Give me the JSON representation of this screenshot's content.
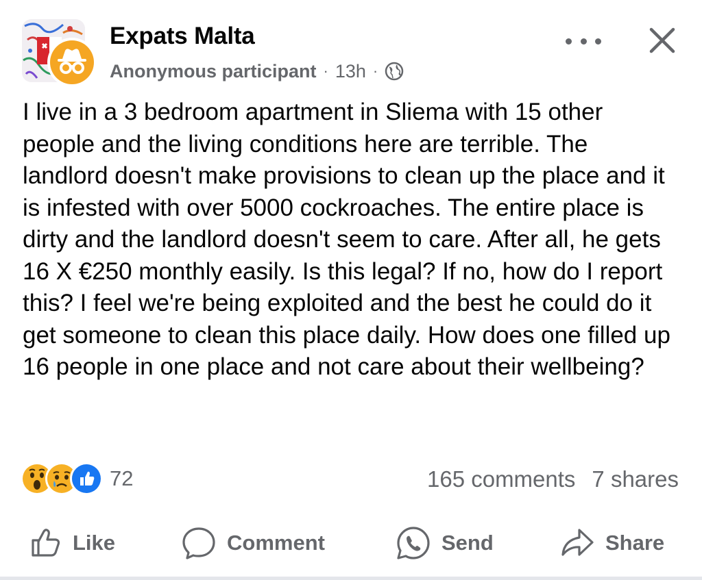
{
  "header": {
    "group_name": "Expats Malta",
    "author": "Anonymous participant",
    "separator": "·",
    "time": "13h",
    "privacy_icon": "globe-icon",
    "more_icon": "more-options-icon",
    "close_icon": "close-icon",
    "avatar_icon": "incognito-icon"
  },
  "post": {
    "text": "I live in a 3 bedroom apartment in Sliema with 15 other people and the living conditions here are terrible. The landlord doesn't make provisions to clean up the place and it is infested with over 5000 cockroaches. The entire place is dirty and the landlord doesn't seem to care. After all, he gets 16 X €250 monthly easily. Is this legal? If no, how do I report this? I feel we're being exploited and the best he could do it get someone to clean this place daily. How does one filled up 16 people in one place and not care about their wellbeing?"
  },
  "engagement": {
    "reaction_icons": [
      "wow-reaction-icon",
      "sad-reaction-icon",
      "like-reaction-icon"
    ],
    "reaction_count": "72",
    "comments": "165 comments",
    "shares": "7 shares"
  },
  "actions": {
    "like": "Like",
    "comment": "Comment",
    "send": "Send",
    "share": "Share"
  },
  "colors": {
    "text": "#050505",
    "secondary": "#65676b",
    "like_blue": "#1877f2",
    "reaction_yellow": "#f7b125",
    "anon_orange": "#f5a623",
    "divider": "#e4e6eb"
  }
}
